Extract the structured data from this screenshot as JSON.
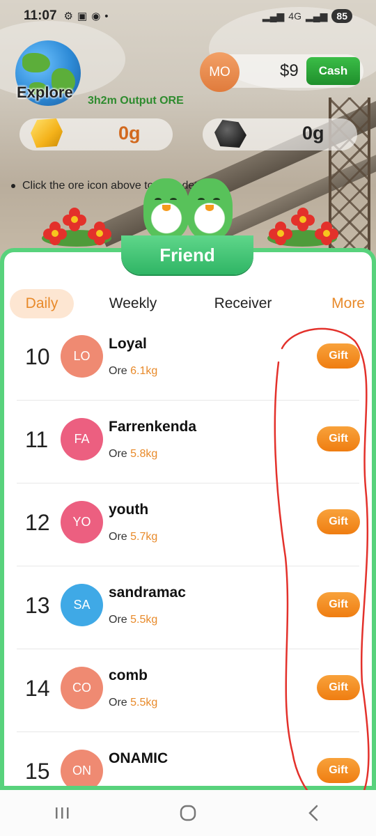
{
  "status_bar": {
    "time": "11:07",
    "network": "4G",
    "battery": "85"
  },
  "header": {
    "explore_label": "Explore",
    "output_label": "3h2m Output ORE",
    "avatar_initials": "MO",
    "balance": "$9",
    "cash_button": "Cash",
    "gold_amount": "0g",
    "coal_amount": "0g",
    "hint_text": "Click the ore icon above to view details."
  },
  "panel": {
    "title": "Friend",
    "tabs": [
      "Daily",
      "Weekly",
      "Receiver",
      "More"
    ],
    "active_tab": "Daily",
    "ore_label": "Ore",
    "gift_label": "Gift",
    "rows": [
      {
        "rank": "10",
        "initials": "LO",
        "name": "Loyal",
        "ore": "6.1kg",
        "avatar_color": "#ef8a72"
      },
      {
        "rank": "11",
        "initials": "FA",
        "name": "Farrenkenda",
        "ore": "5.8kg",
        "avatar_color": "#ec5f80"
      },
      {
        "rank": "12",
        "initials": "YO",
        "name": "youth",
        "ore": "5.7kg",
        "avatar_color": "#ec5f80"
      },
      {
        "rank": "13",
        "initials": "SA",
        "name": "sandramac",
        "ore": "5.5kg",
        "avatar_color": "#3fa9e6"
      },
      {
        "rank": "14",
        "initials": "CO",
        "name": "comb",
        "ore": "5.5kg",
        "avatar_color": "#ef8a72"
      },
      {
        "rank": "15",
        "initials": "ON",
        "name": "ONAMIC",
        "ore": "",
        "avatar_color": "#ef8a72"
      }
    ]
  },
  "colors": {
    "accent_green": "#58d27c",
    "accent_orange": "#ef7d11",
    "annotation_red": "#e3312b"
  },
  "nav": {
    "icons": [
      "recent-apps-icon",
      "home-icon",
      "back-icon"
    ]
  }
}
